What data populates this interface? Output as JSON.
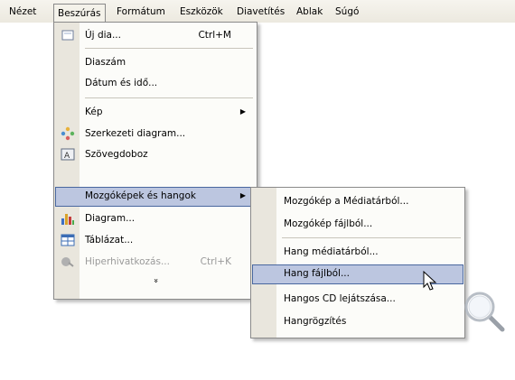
{
  "menubar": {
    "items": [
      "Nézet",
      "Beszúrás",
      "Formátum",
      "Eszközök",
      "Diavetítés",
      "Ablak",
      "Súgó"
    ]
  },
  "insert_menu": {
    "items": [
      {
        "label": "Új dia...",
        "shortcut": "Ctrl+M",
        "icon": "new-slide-icon"
      },
      {
        "label": "Diaszám"
      },
      {
        "label": "Dátum és idő..."
      },
      {
        "label": "Kép",
        "submenu": true
      },
      {
        "label": "Szerkezeti diagram...",
        "icon": "org-chart-icon"
      },
      {
        "label": "Szövegdoboz",
        "icon": "textbox-icon"
      },
      {
        "label": "Mozgóképek és hangok",
        "submenu": true,
        "highlighted": true
      },
      {
        "label": "Diagram...",
        "icon": "chart-icon"
      },
      {
        "label": "Táblázat...",
        "icon": "table-icon"
      },
      {
        "label": "Hiperhivatkozás...",
        "shortcut": "Ctrl+K",
        "icon": "hyperlink-icon",
        "disabled": true
      }
    ],
    "expand_glyph": "»"
  },
  "media_submenu": {
    "items": [
      {
        "label": "Mozgókép a Médiatárból..."
      },
      {
        "label": "Mozgókép fájlból..."
      },
      {
        "label": "Hang médiatárból..."
      },
      {
        "label": "Hang fájlból...",
        "highlighted": true
      },
      {
        "label": "Hangos CD lejátszása..."
      },
      {
        "label": "Hangrögzítés"
      }
    ]
  },
  "colors": {
    "highlight": "#bcc6e0",
    "highlight_border": "#49679f"
  }
}
